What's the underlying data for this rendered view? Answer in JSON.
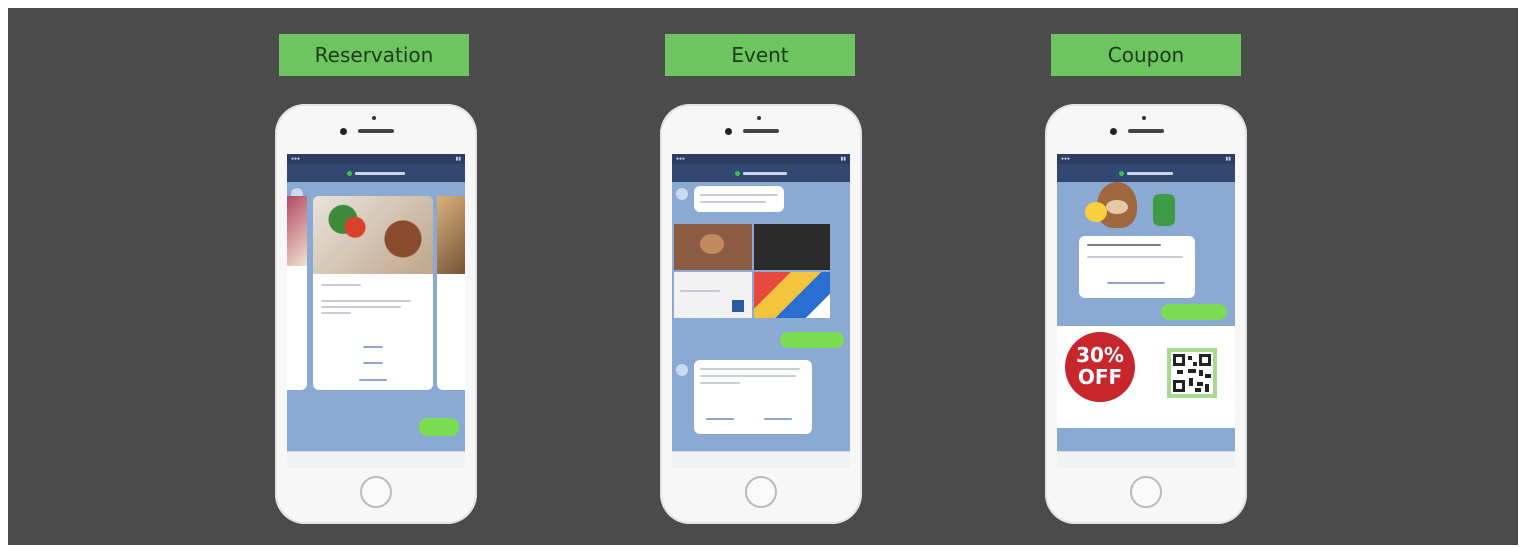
{
  "labels": {
    "reservation": "Reservation",
    "event": "Event",
    "coupon": "Coupon"
  },
  "coupon_card": {
    "percent": "30%",
    "off": "OFF"
  },
  "colors": {
    "background": "#4a4b4a",
    "label_green": "#6cc55e",
    "chat_blue": "#8aaad4",
    "header_navy": "#324872",
    "bubble_green": "#7bdd52",
    "coupon_red": "#c8262d"
  },
  "icons": [
    "camera-icon",
    "speaker-grille",
    "home-button-icon",
    "qr-code-icon",
    "avatar-icon"
  ]
}
